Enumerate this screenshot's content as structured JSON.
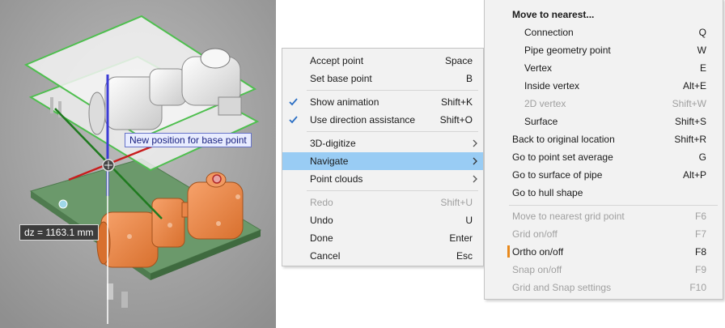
{
  "viewport": {
    "tooltip": "New position for base point",
    "dz_readout": "dz = 1163.1 mm"
  },
  "context_menu": {
    "items": [
      {
        "label": "Accept point",
        "shortcut": "Space"
      },
      {
        "label": "Set base point",
        "shortcut": "B"
      },
      {
        "label": "Show animation",
        "shortcut": "Shift+K",
        "checked": true
      },
      {
        "label": "Use direction assistance",
        "shortcut": "Shift+O",
        "checked": true
      },
      {
        "label": "3D-digitize",
        "submenu": true
      },
      {
        "label": "Navigate",
        "submenu": true,
        "highlighted": true
      },
      {
        "label": "Point clouds",
        "submenu": true
      },
      {
        "label": "Redo",
        "shortcut": "Shift+U",
        "disabled": true
      },
      {
        "label": "Undo",
        "shortcut": "U"
      },
      {
        "label": "Done",
        "shortcut": "Enter"
      },
      {
        "label": "Cancel",
        "shortcut": "Esc"
      }
    ]
  },
  "navigate_submenu": {
    "header": "Move to nearest...",
    "items": [
      {
        "label": "Connection",
        "shortcut": "Q"
      },
      {
        "label": "Pipe geometry point",
        "shortcut": "W"
      },
      {
        "label": "Vertex",
        "shortcut": "E"
      },
      {
        "label": "Inside vertex",
        "shortcut": "Alt+E"
      },
      {
        "label": "2D vertex",
        "shortcut": "Shift+W",
        "disabled": true
      },
      {
        "label": "Surface",
        "shortcut": "Shift+S"
      },
      {
        "label": "Back to original location",
        "shortcut": "Shift+R"
      },
      {
        "label": "Go to point set average",
        "shortcut": "G"
      },
      {
        "label": "Go to surface of pipe",
        "shortcut": "Alt+P"
      },
      {
        "label": "Go to hull shape",
        "shortcut": ""
      },
      {
        "label": "Move to nearest grid point",
        "shortcut": "F6",
        "disabled": true
      },
      {
        "label": "Grid on/off",
        "shortcut": "F7",
        "disabled": true
      },
      {
        "label": "Ortho on/off",
        "shortcut": "F8",
        "active": true
      },
      {
        "label": "Snap on/off",
        "shortcut": "F9",
        "disabled": true
      },
      {
        "label": "Grid and Snap settings",
        "shortcut": "F10",
        "disabled": true
      }
    ]
  },
  "colors": {
    "accent_highlight": "#99ccf4",
    "ortho_marker": "#e8891c",
    "check": "#2b6fc4",
    "orange_model": "#f08a4b",
    "green_plate": "#5a8a5a"
  }
}
